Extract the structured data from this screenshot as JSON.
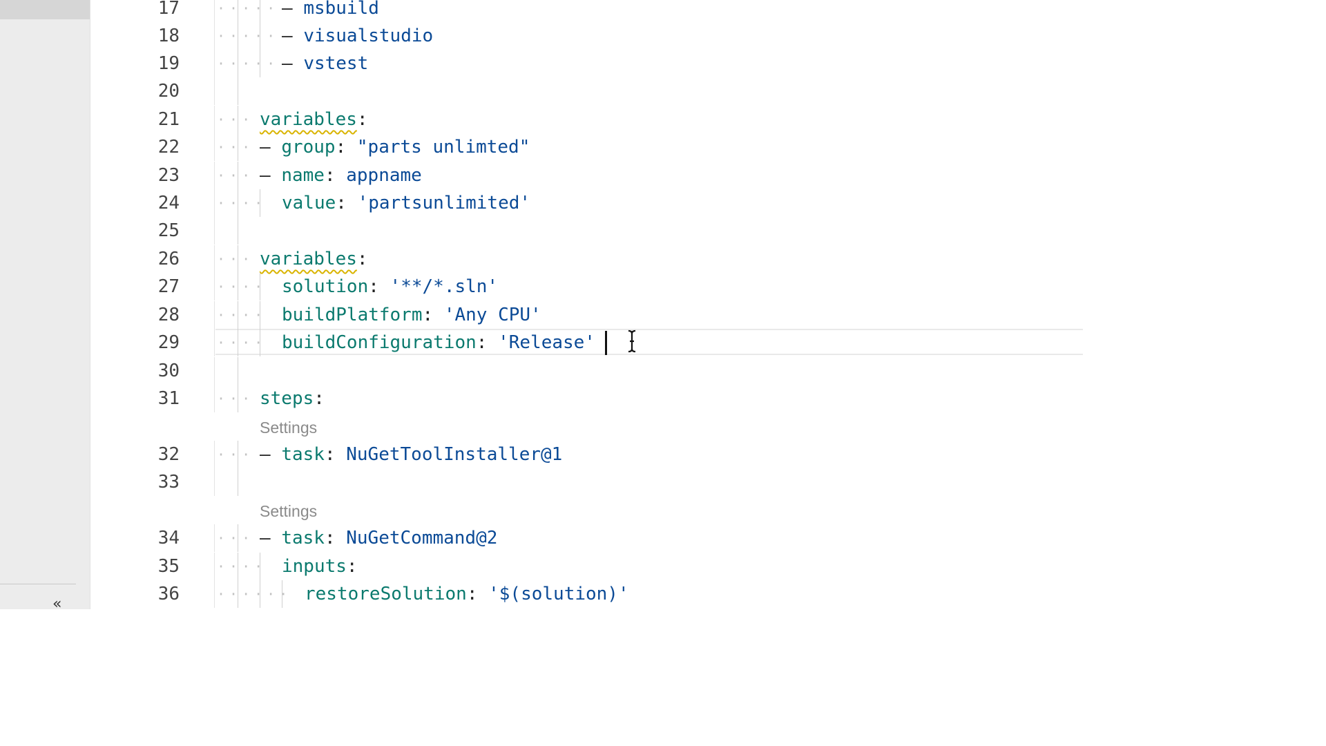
{
  "sidebar": {
    "collapse_glyph": "«",
    "collapse_icon": "double-chevron-left-icon"
  },
  "codelens": {
    "label": "Settings"
  },
  "editor": {
    "lines": [
      {
        "num": "17",
        "tokens": [
          [
            "p",
            "– "
          ],
          [
            "v",
            "msbuild"
          ]
        ]
      },
      {
        "num": "18",
        "tokens": [
          [
            "p",
            "– "
          ],
          [
            "v",
            "visualstudio"
          ]
        ]
      },
      {
        "num": "19",
        "tokens": [
          [
            "p",
            "– "
          ],
          [
            "v",
            "vstest"
          ]
        ]
      },
      {
        "num": "20",
        "tokens": []
      },
      {
        "num": "21",
        "tokens": [
          [
            "k squiggle",
            "variables"
          ],
          [
            "p",
            ":"
          ]
        ]
      },
      {
        "num": "22",
        "tokens": [
          [
            "p",
            "– "
          ],
          [
            "k",
            "group"
          ],
          [
            "p",
            ": "
          ],
          [
            "v",
            "\"parts unlimted\""
          ]
        ]
      },
      {
        "num": "23",
        "tokens": [
          [
            "p",
            "– "
          ],
          [
            "k",
            "name"
          ],
          [
            "p",
            ": "
          ],
          [
            "v",
            "appname"
          ]
        ]
      },
      {
        "num": "24",
        "tokens": [
          [
            "k",
            "value"
          ],
          [
            "p",
            ": "
          ],
          [
            "v",
            "'partsunlimited'"
          ]
        ]
      },
      {
        "num": "25",
        "tokens": []
      },
      {
        "num": "26",
        "tokens": [
          [
            "k squiggle",
            "variables"
          ],
          [
            "p",
            ":"
          ]
        ]
      },
      {
        "num": "27",
        "tokens": [
          [
            "k",
            "solution"
          ],
          [
            "p",
            ": "
          ],
          [
            "v",
            "'**/*.sln'"
          ]
        ]
      },
      {
        "num": "28",
        "tokens": [
          [
            "k",
            "buildPlatform"
          ],
          [
            "p",
            ": "
          ],
          [
            "v",
            "'Any CPU'"
          ]
        ]
      },
      {
        "num": "29",
        "tokens": [
          [
            "k",
            "buildConfiguration"
          ],
          [
            "p",
            ": "
          ],
          [
            "v",
            "'Release'"
          ]
        ]
      },
      {
        "num": "30",
        "tokens": []
      },
      {
        "num": "31",
        "tokens": [
          [
            "k",
            "steps"
          ],
          [
            "p",
            ":"
          ]
        ]
      },
      {
        "num": "32",
        "tokens": [
          [
            "p",
            "– "
          ],
          [
            "k",
            "task"
          ],
          [
            "p",
            ": "
          ],
          [
            "v",
            "NuGetToolInstaller@1"
          ]
        ]
      },
      {
        "num": "33",
        "tokens": []
      },
      {
        "num": "34",
        "tokens": [
          [
            "p",
            "– "
          ],
          [
            "k",
            "task"
          ],
          [
            "p",
            ": "
          ],
          [
            "v",
            "NuGetCommand@2"
          ]
        ]
      },
      {
        "num": "35",
        "tokens": [
          [
            "k",
            "inputs"
          ],
          [
            "p",
            ":"
          ]
        ]
      },
      {
        "num": "36",
        "tokens": [
          [
            "k",
            "restoreSolution"
          ],
          [
            "p",
            ": "
          ],
          [
            "v",
            "'$(solution)'"
          ]
        ]
      }
    ]
  }
}
